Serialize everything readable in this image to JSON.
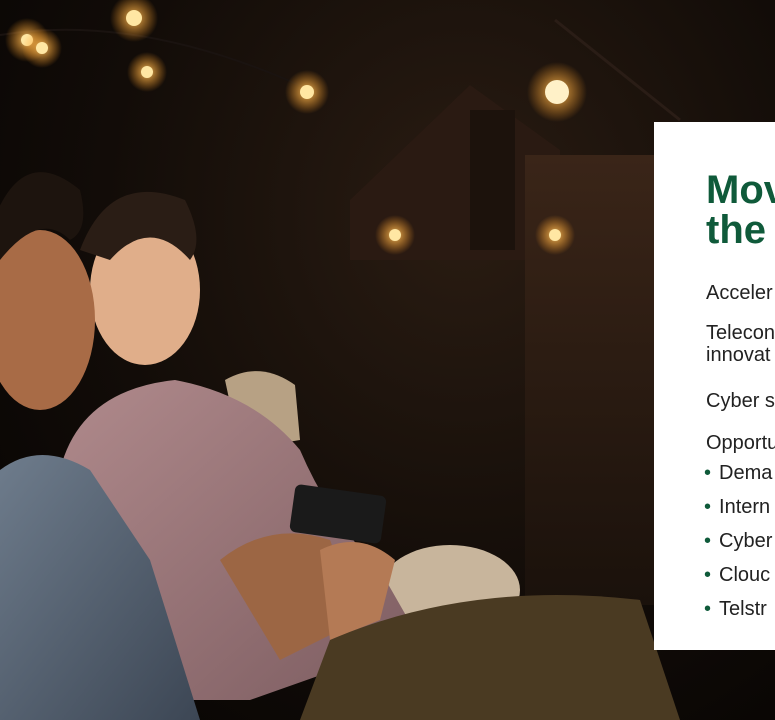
{
  "card": {
    "title": "Mov\nthe",
    "paragraphs": [
      "Acceler",
      "Telecon",
      "innovat",
      "Cyber s",
      "Opportu"
    ],
    "bullets": [
      "Dema",
      "Intern",
      "Cyber",
      "Clouc",
      "Telstr"
    ]
  },
  "colors": {
    "title_green": "#0f5a3a",
    "card_bg": "#ffffff",
    "text": "#222222"
  }
}
